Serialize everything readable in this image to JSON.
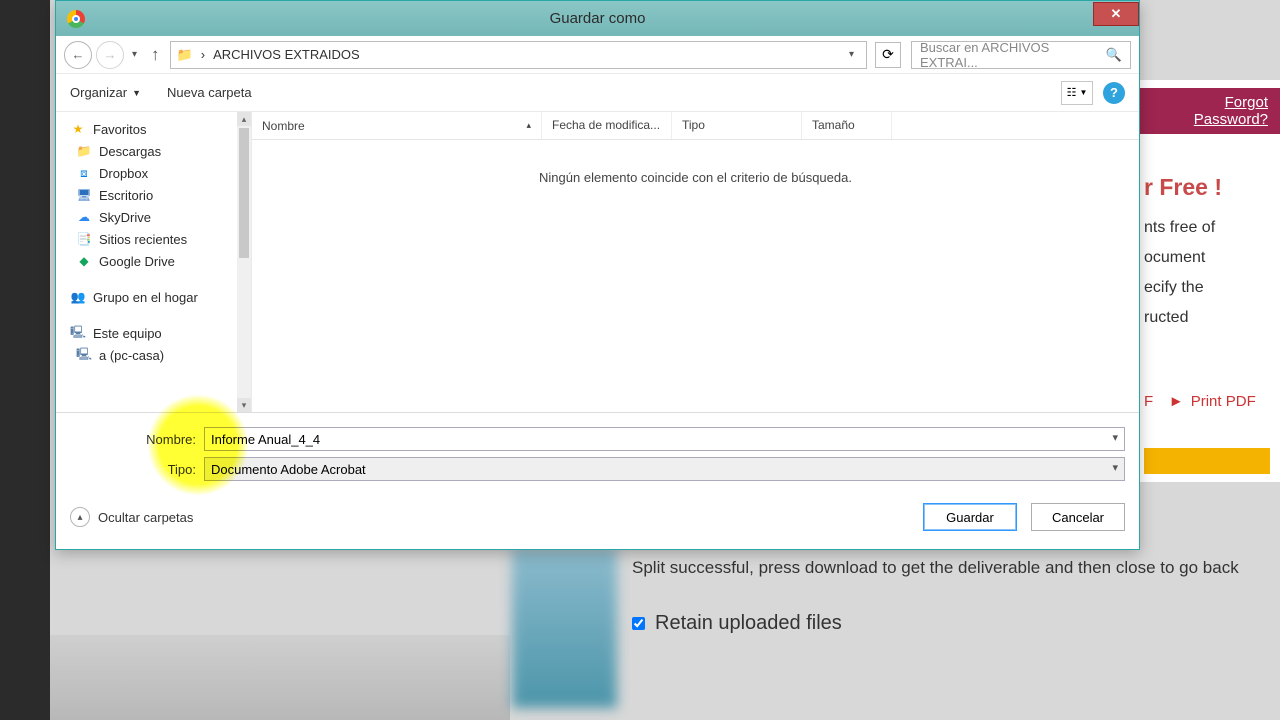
{
  "dialog": {
    "title": "Guardar como",
    "breadcrumb": "ARCHIVOS EXTRAIDOS",
    "search_placeholder": "Buscar en ARCHIVOS EXTRAI...",
    "toolbar": {
      "organize": "Organizar",
      "new_folder": "Nueva carpeta"
    },
    "sidebar": {
      "favorites": "Favoritos",
      "items_fav": [
        "Descargas",
        "Dropbox",
        "Escritorio",
        "SkyDrive",
        "Sitios recientes",
        "Google Drive"
      ],
      "homegroup": "Grupo en el hogar",
      "this_pc": "Este equipo",
      "pc_items": [
        "a (pc-casa)"
      ]
    },
    "columns": [
      "Nombre",
      "Fecha de modifica...",
      "Tipo",
      "Tamaño"
    ],
    "empty": "Ningún elemento coincide con el criterio de búsqueda.",
    "labels": {
      "name": "Nombre:",
      "type": "Tipo:"
    },
    "file_name": "Informe Anual_4_4",
    "file_type": "Documento Adobe Acrobat",
    "hide_folders": "Ocultar carpetas",
    "buttons": {
      "save": "Guardar",
      "cancel": "Cancelar"
    }
  },
  "background": {
    "forgot": "Forgot Password?",
    "head": "r Free !",
    "p1": "nts free of",
    "p2": "ocument",
    "p3": "ecify the",
    "p4": "ructed",
    "print": "Print PDF",
    "f": "F",
    "msg": "Split successful, press download to get the deliverable and then close to go back",
    "retain": "Retain uploaded files"
  }
}
